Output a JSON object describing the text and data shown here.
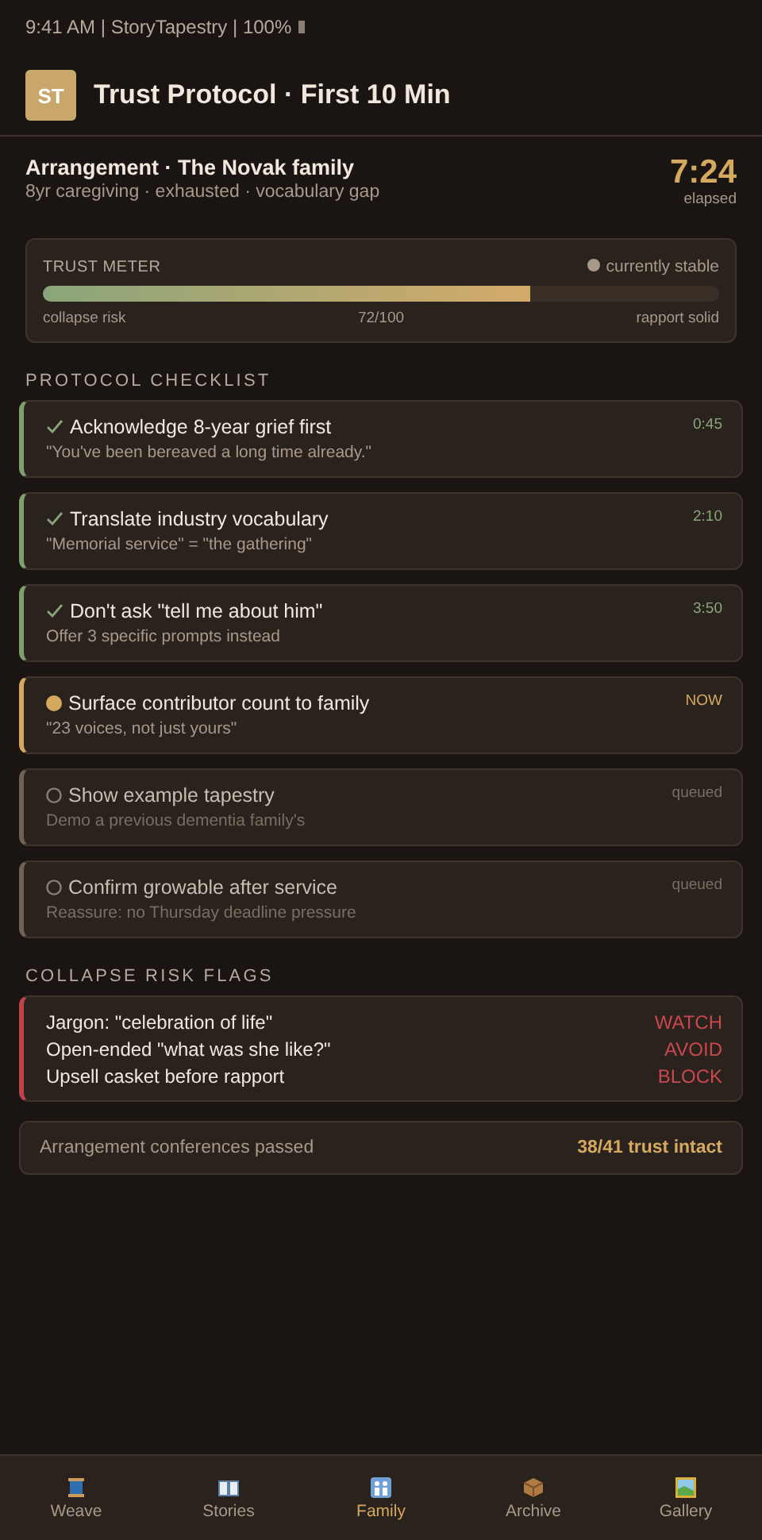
{
  "status_bar": {
    "text": "9:41 AM | StoryTapestry | 100%"
  },
  "header": {
    "logo": "ST",
    "title": "Trust Protocol · First 10 Min"
  },
  "family": {
    "title": "Arrangement · The Novak family",
    "subtitle": "8yr caregiving · exhausted · vocabulary gap",
    "timer": "7:24",
    "timer_label": "elapsed"
  },
  "trust_meter": {
    "title": "TRUST METER",
    "status": "currently stable",
    "level": 0.72,
    "left_label": "collapse risk",
    "reading": "72/100",
    "right_label": "rapport solid"
  },
  "checklist": {
    "title": "PROTOCOL CHECKLIST",
    "items": [
      {
        "kind": "done",
        "title": "Acknowledge 8-year grief first",
        "detail": "\"You've been bereaved a long time already.\"",
        "time": "0:45"
      },
      {
        "kind": "done",
        "title": "Translate industry vocabulary",
        "detail": "\"Memorial service\" = \"the gathering\"",
        "time": "2:10"
      },
      {
        "kind": "done",
        "title": "Don't ask \"tell me about him\"",
        "detail": "Offer 3 specific prompts instead",
        "time": "3:50"
      },
      {
        "kind": "now",
        "title": "Surface contributor count to family",
        "detail": "\"23 voices, not just yours\"",
        "time": "NOW"
      },
      {
        "kind": "queued",
        "title": "Show example tapestry",
        "detail": "Demo a previous dementia family's",
        "time": "queued"
      },
      {
        "kind": "queued",
        "title": "Confirm growable after service",
        "detail": "Reassure: no Thursday deadline pressure",
        "time": "queued"
      }
    ]
  },
  "risk_flags": {
    "title": "COLLAPSE RISK FLAGS",
    "items": [
      {
        "label": "Jargon: \"celebration of life\"",
        "action": "WATCH"
      },
      {
        "label": "Open-ended \"what was she like?\"",
        "action": "AVOID"
      },
      {
        "label": "Upsell casket before rapport",
        "action": "BLOCK"
      }
    ]
  },
  "summary": {
    "label": "Arrangement conferences passed",
    "value": "38/41 trust intact"
  },
  "tabs": [
    {
      "label": "Weave",
      "kind": "spool",
      "selected": false
    },
    {
      "label": "Stories",
      "kind": "book",
      "selected": false
    },
    {
      "label": "Family",
      "kind": "family",
      "selected": true
    },
    {
      "label": "Archive",
      "kind": "box",
      "selected": false
    },
    {
      "label": "Gallery",
      "kind": "frame",
      "selected": false
    }
  ]
}
